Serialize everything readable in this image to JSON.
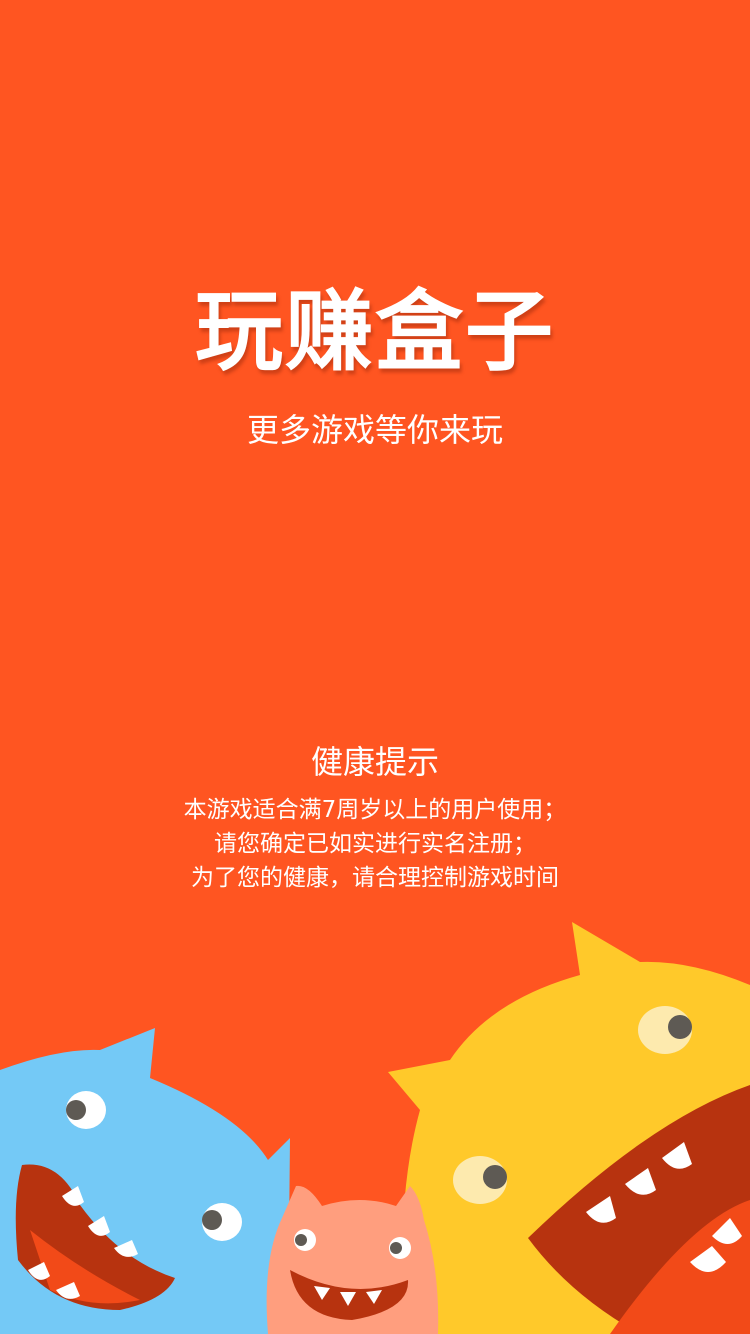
{
  "colors": {
    "background": "#FF5521",
    "monster_blue": "#74C9F6",
    "monster_yellow": "#FFC92A",
    "monster_pink": "#FF9E7E",
    "mouth_dark": "#B7330F",
    "mouth_light": "#F24A18",
    "eye_pupil": "#5E5A54"
  },
  "splash": {
    "title": "玩赚盒子",
    "subtitle": "更多游戏等你来玩"
  },
  "health_notice": {
    "title": "健康提示",
    "lines": [
      "本游戏适合满7周岁以上的用户使用；",
      "请您确定已如实进行实名注册；",
      "为了您的健康，请合理控制游戏时间"
    ]
  },
  "illustration": {
    "monsters": [
      "blue-monster",
      "pink-monster",
      "yellow-monster"
    ]
  }
}
